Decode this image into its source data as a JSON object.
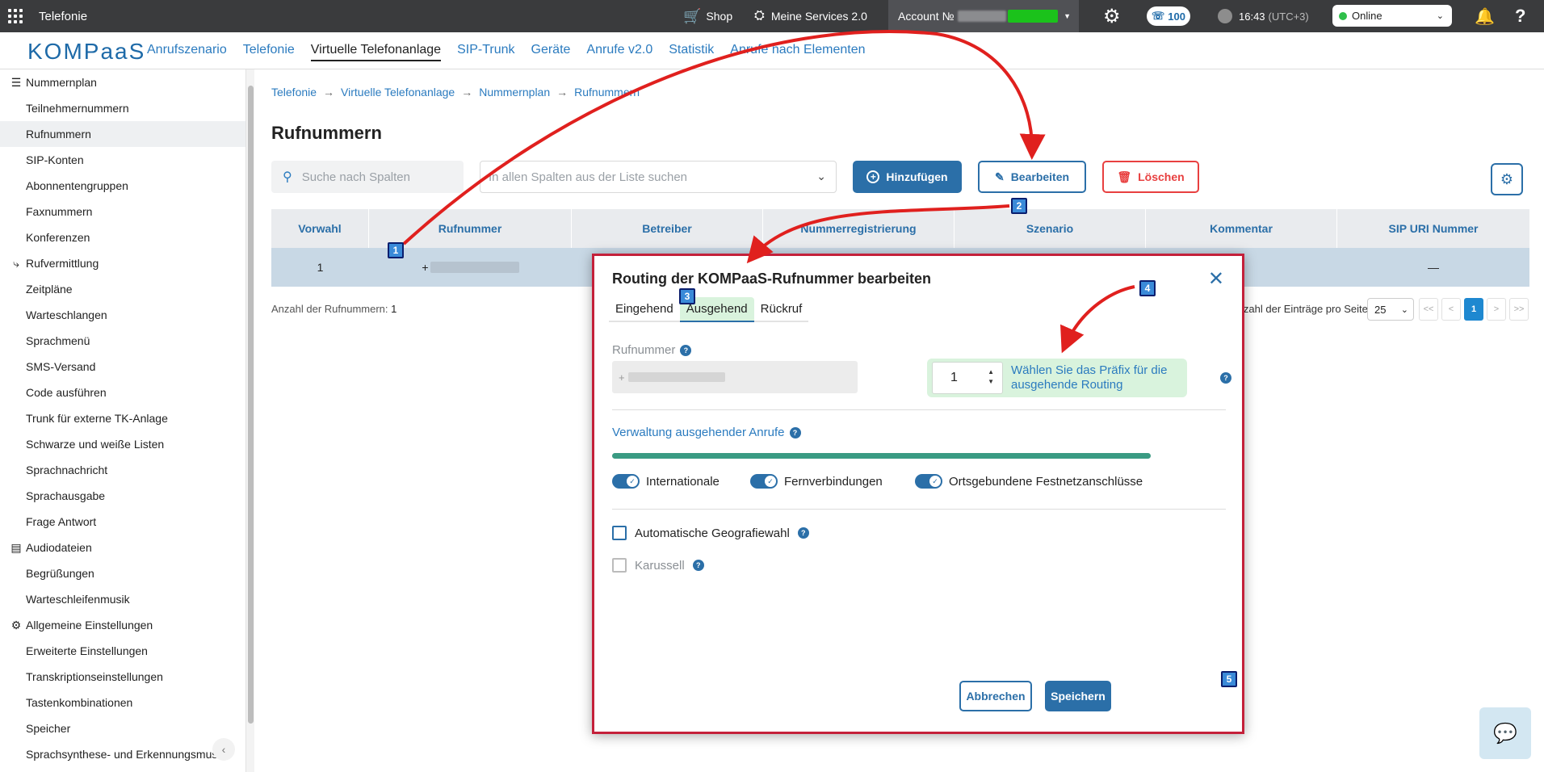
{
  "topbar": {
    "app_title": "Telefonie",
    "shop": "Shop",
    "services": "Meine Services 2.0",
    "account_label": "Account №",
    "calls_count": "100",
    "time": "16:43",
    "timezone": "(UTC+3)",
    "status": "Online"
  },
  "logo": "KOMPaaS",
  "nav": [
    {
      "label": "Anrufszenario"
    },
    {
      "label": "Telefonie"
    },
    {
      "label": "Virtuelle Telefonanlage",
      "active": true
    },
    {
      "label": "SIP-Trunk"
    },
    {
      "label": "Geräte"
    },
    {
      "label": "Anrufe v2.0"
    },
    {
      "label": "Statistik"
    },
    {
      "label": "Anrufe nach Elementen"
    }
  ],
  "sidebar": {
    "sections": [
      {
        "title": "Nummernplan",
        "items": [
          "Teilnehmernummern",
          "Rufnummern",
          "SIP-Konten",
          "Abonnentengruppen",
          "Faxnummern",
          "Konferenzen"
        ]
      },
      {
        "title": "Rufvermittlung",
        "items": [
          "Zeitpläne",
          "Warteschlangen",
          "Sprachmenü",
          "SMS-Versand",
          "Code ausführen",
          "Trunk für externe TK-Anlage",
          "Schwarze und weiße Listen",
          "Sprachnachricht",
          "Sprachausgabe",
          "Frage Antwort"
        ]
      },
      {
        "title": "Audiodateien",
        "items": [
          "Begrüßungen",
          "Warteschleifenmusik"
        ]
      },
      {
        "title": "Allgemeine Einstellungen",
        "items": [
          "Erweiterte Einstellungen",
          "Transkriptionseinstellungen",
          "Tastenkombinationen",
          "Speicher",
          "Sprachsynthese- und Erkennungsmus"
        ]
      }
    ]
  },
  "breadcrumb": [
    "Telefonie",
    "Virtuelle Telefonanlage",
    "Nummernplan",
    "Rufnummern"
  ],
  "page_title": "Rufnummern",
  "toolbar": {
    "search_columns_placeholder": "Suche nach Spalten",
    "search_all_placeholder": "In allen Spalten aus der Liste suchen",
    "add_label": "Hinzufügen",
    "edit_label": "Bearbeiten",
    "delete_label": "Löschen"
  },
  "table": {
    "columns": [
      "Vorwahl",
      "Rufnummer",
      "Betreiber",
      "Nummerregistrierung",
      "Szenario",
      "Kommentar",
      "SIP URI Nummer"
    ],
    "rows": [
      {
        "vorwahl": "1",
        "rufnummer": "+",
        "sip_uri": "—"
      }
    ]
  },
  "footer": {
    "count_label": "Anzahl der Rufnummern:",
    "count_value": "1",
    "per_page_label": "Anzahl der Einträge pro Seite",
    "per_page_value": "25",
    "pager": [
      "<<",
      "<",
      "1",
      ">",
      ">>"
    ]
  },
  "modal": {
    "title": "Routing der KOMPaaS-Rufnummer bearbeiten",
    "tabs": [
      "Eingehend",
      "Ausgehend",
      "Rückruf"
    ],
    "active_tab": "Ausgehend",
    "rufnummer_label": "Rufnummer",
    "rufnummer_value": "+",
    "prefix_value": "1",
    "prefix_hint": "Wählen Sie das Präfix für die ausgehende Routing",
    "outgoing_section": "Verwaltung ausgehender Anrufe",
    "progress_fraction": 1.0,
    "toggles": [
      {
        "label": "Internationale",
        "on": true
      },
      {
        "label": "Fernverbindungen",
        "on": true
      },
      {
        "label": "Ortsgebundene Festnetzanschlüsse",
        "on": true
      }
    ],
    "checkboxes": [
      {
        "label": "Automatische Geografiewahl",
        "checked": false,
        "disabled": false
      },
      {
        "label": "Karussell",
        "checked": false,
        "disabled": true
      }
    ],
    "cancel_label": "Abbrechen",
    "save_label": "Speichern"
  },
  "annotations": [
    "1",
    "2",
    "3",
    "4",
    "5"
  ],
  "colors": {
    "brand": "#2b6fa8",
    "accent_red": "#e84040",
    "modal_border": "#c4203a",
    "arrow": "#e0201e",
    "progress": "#3a9b83",
    "tab_active_bg": "#d9f3dd"
  }
}
